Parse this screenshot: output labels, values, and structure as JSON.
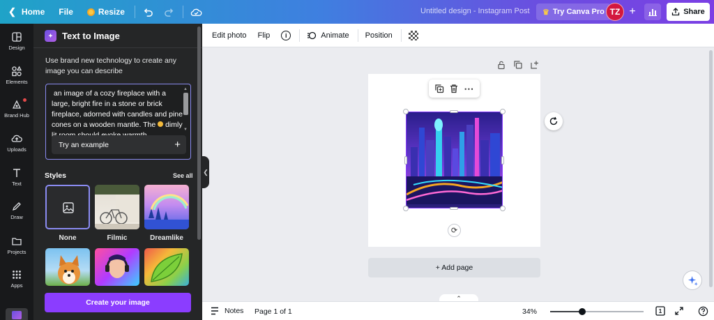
{
  "topbar": {
    "home": "Home",
    "file": "File",
    "resize": "Resize",
    "title": "Untitled design - Instagram Post",
    "try_pro": "Try Canva Pro",
    "avatar_initials": "TZ",
    "share": "Share"
  },
  "rail": {
    "items": [
      {
        "label": "Design",
        "icon": "design-icon"
      },
      {
        "label": "Elements",
        "icon": "elements-icon"
      },
      {
        "label": "Brand Hub",
        "icon": "brand-hub-icon"
      },
      {
        "label": "Uploads",
        "icon": "upload-icon"
      },
      {
        "label": "Text",
        "icon": "text-icon"
      },
      {
        "label": "Draw",
        "icon": "draw-icon"
      },
      {
        "label": "Projects",
        "icon": "folder-icon"
      },
      {
        "label": "Apps",
        "icon": "apps-grid-icon"
      }
    ]
  },
  "panel": {
    "title": "Text to Image",
    "description": "Use brand new technology to create any image you can describe",
    "prompt": "an image of a cozy fireplace with a large, bright fire in a stone or brick fireplace, adorned with candles and pine cones on a wooden mantle. The",
    "prompt_cutoff": "dimly lit room should evoke warmth",
    "try_example": "Try an example",
    "styles_heading": "Styles",
    "see_all": "See all",
    "styles": [
      {
        "label": "None"
      },
      {
        "label": "Filmic"
      },
      {
        "label": "Dreamlike"
      }
    ],
    "create_button": "Create your image"
  },
  "context_toolbar": {
    "edit_photo": "Edit photo",
    "flip": "Flip",
    "animate": "Animate",
    "position": "Position"
  },
  "canvas": {
    "add_page": "+ Add page"
  },
  "bottombar": {
    "notes": "Notes",
    "page_indicator": "Page 1 of 1",
    "zoom": "34%",
    "zoom_fraction": 0.34,
    "page_count_badge": "1"
  },
  "colors": {
    "accent": "#8b3dff",
    "avatar": "#d3173e",
    "panel_bg": "#252627",
    "rail_bg": "#18191b"
  }
}
